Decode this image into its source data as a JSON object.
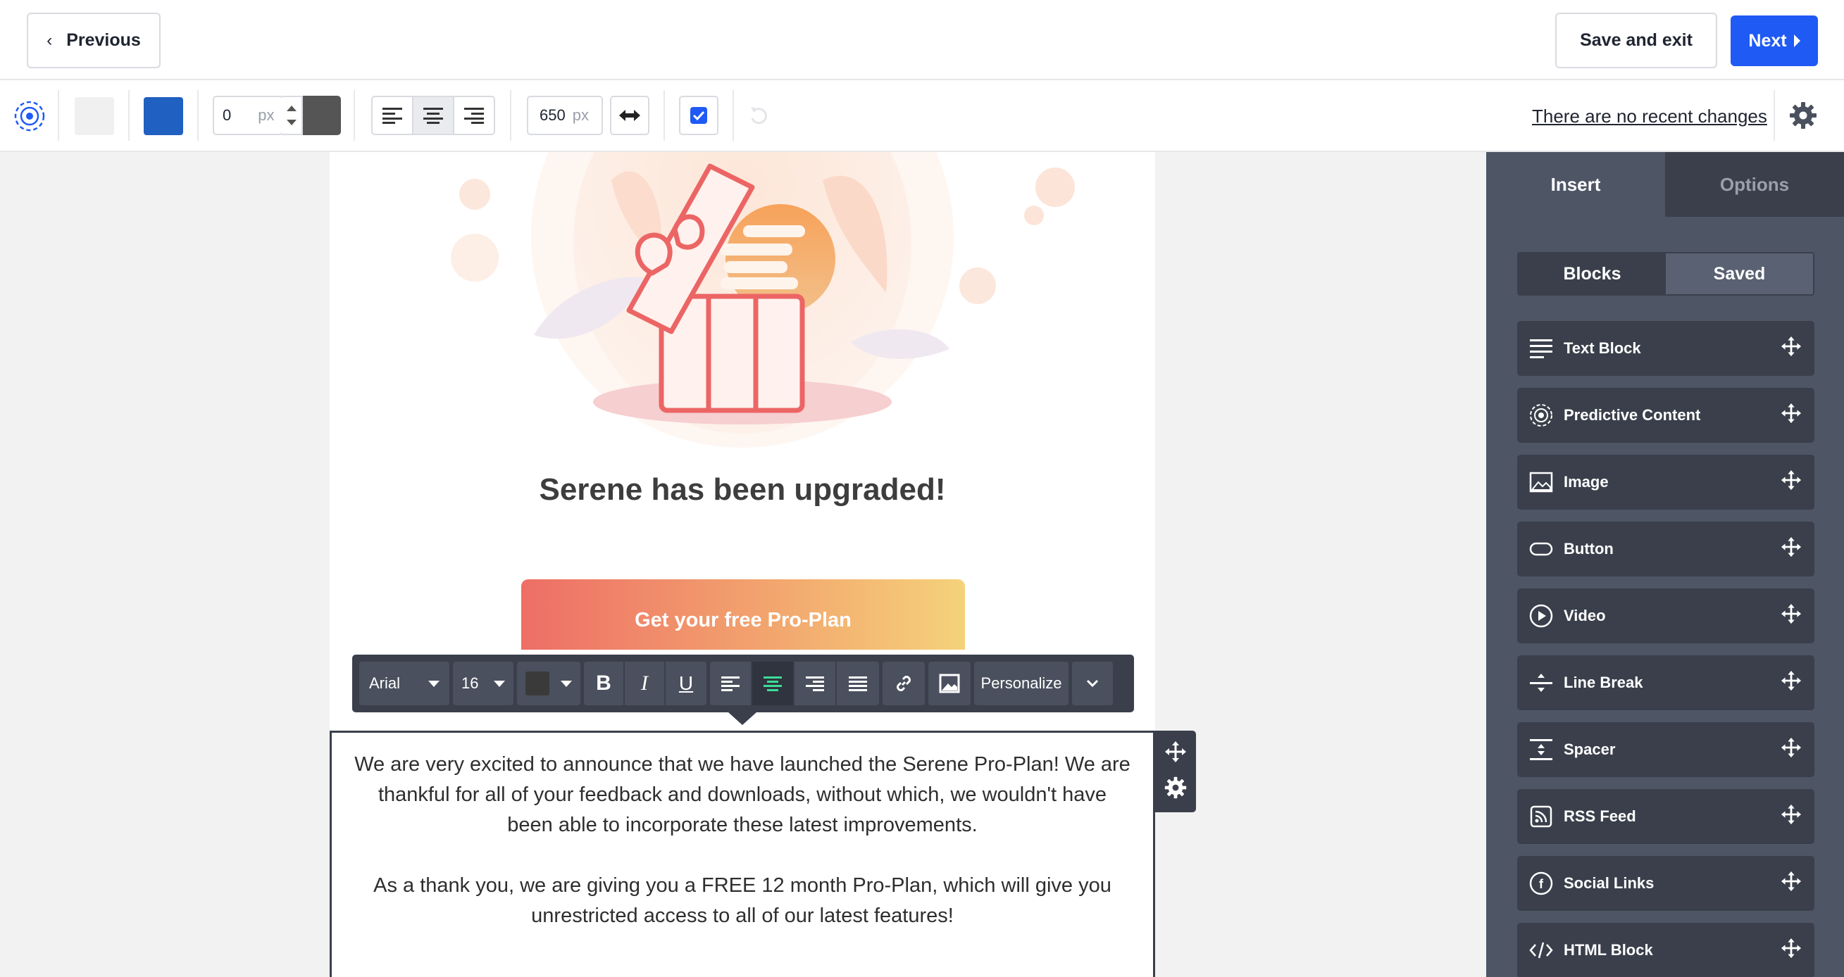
{
  "header": {
    "previous_label": "Previous",
    "save_exit_label": "Save and exit",
    "next_label": "Next",
    "accent_color": "#1f5af5"
  },
  "toolbar": {
    "background_swatch_color": "#f0f0f0",
    "body_swatch_color": "#2060c0",
    "border_width_value": "0",
    "border_width_unit": "px",
    "border_color": "#555555",
    "content_width_value": "650",
    "content_width_unit": "px",
    "alignment_selected": "center",
    "checkbox_checked": true,
    "recent_changes_label": "There are no recent changes"
  },
  "email": {
    "headline": "Serene has been upgraded!",
    "cta_label": "Get your free Pro-Plan",
    "paragraph_1": "We are very excited to announce that we have launched the Serene Pro-Plan! We are thankful for all of your feedback and downloads, without which, we wouldn't have been able to incorporate these latest improvements.",
    "paragraph_2": "As a thank you, we are giving you a FREE 12 month Pro-Plan, which will give you unrestricted access to all of our latest features!"
  },
  "format_toolbar": {
    "font_family": "Arial",
    "font_size": "16",
    "text_color": "#3a3a3a",
    "personalize_label": "Personalize",
    "active_alignment": "center"
  },
  "panel": {
    "tabs": [
      {
        "label": "Insert",
        "active": true
      },
      {
        "label": "Options",
        "active": false
      }
    ],
    "segments": [
      {
        "label": "Blocks",
        "active": true
      },
      {
        "label": "Saved",
        "active": false
      }
    ],
    "blocks": [
      {
        "label": "Text Block",
        "icon": "text-lines-icon"
      },
      {
        "label": "Predictive Content",
        "icon": "predictive-target-icon"
      },
      {
        "label": "Image",
        "icon": "image-icon"
      },
      {
        "label": "Button",
        "icon": "button-pill-icon"
      },
      {
        "label": "Video",
        "icon": "play-circle-icon"
      },
      {
        "label": "Line Break",
        "icon": "line-break-icon"
      },
      {
        "label": "Spacer",
        "icon": "spacer-icon"
      },
      {
        "label": "RSS Feed",
        "icon": "rss-icon"
      },
      {
        "label": "Social Links",
        "icon": "facebook-circle-icon"
      },
      {
        "label": "HTML Block",
        "icon": "code-brackets-icon"
      }
    ]
  }
}
